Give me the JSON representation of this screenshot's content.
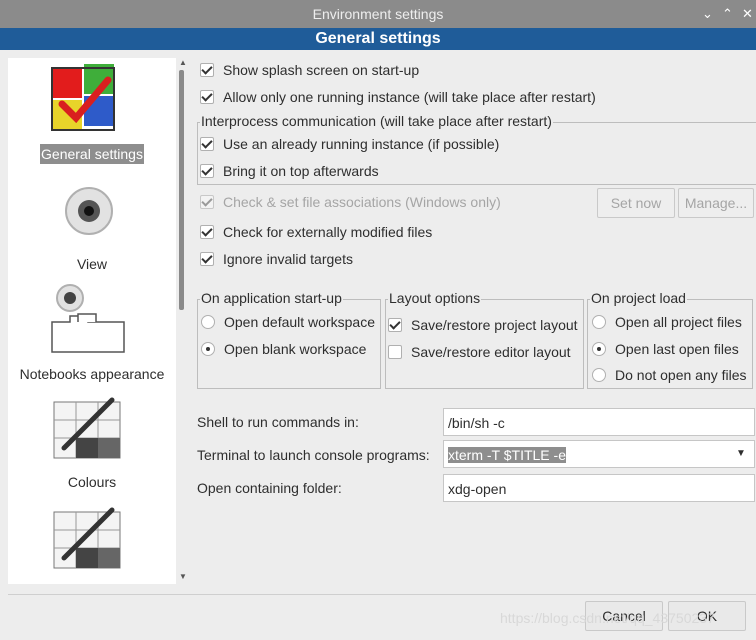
{
  "window": {
    "title": "Environment settings",
    "header": "General settings",
    "controls": {
      "minimize": "⌄",
      "maximize": "⌃",
      "close": "✕"
    }
  },
  "sidebar": {
    "items": [
      {
        "label": "General settings",
        "selected": true
      },
      {
        "label": "View"
      },
      {
        "label": "Notebooks appearance"
      },
      {
        "label": "Colours"
      }
    ]
  },
  "general": {
    "splash": "Show splash screen on start-up",
    "single_instance": "Allow only one running instance (will take place after restart)",
    "ipc_title": "Interprocess communication (will take place after restart)",
    "ipc_use_running": "Use an already running instance (if possible)",
    "ipc_bring_top": "Bring it on top afterwards",
    "file_assoc": "Check & set file associations (Windows only)",
    "set_now": "Set now",
    "manage": "Manage...",
    "check_modified": "Check for externally modified files",
    "ignore_invalid": "Ignore invalid targets"
  },
  "startup": {
    "title": "On application start-up",
    "options": [
      "Open default workspace",
      "Open blank workspace"
    ],
    "selected": "Open blank workspace"
  },
  "layout": {
    "title": "Layout options",
    "save_project": "Save/restore project layout",
    "save_editor": "Save/restore editor layout"
  },
  "project_load": {
    "title": "On project load",
    "options": [
      "Open all project files",
      "Open last open files",
      "Do not open any files"
    ],
    "selected": "Open last open files"
  },
  "commands": {
    "shell_label": "Shell to run commands in:",
    "shell_value": "/bin/sh -c",
    "terminal_label": "Terminal to launch console programs:",
    "terminal_value": "xterm -T $TITLE -e",
    "folder_label": "Open containing folder:",
    "folder_value": "xdg-open"
  },
  "footer": {
    "cancel": "Cancel",
    "ok": "OK",
    "watermark": "https://blog.csdn.net/qq_43750237"
  },
  "colors": {
    "header_bg": "#1f5c99",
    "titlebar_bg": "#8b8b8b",
    "selection_bg": "#8e8e8e"
  }
}
